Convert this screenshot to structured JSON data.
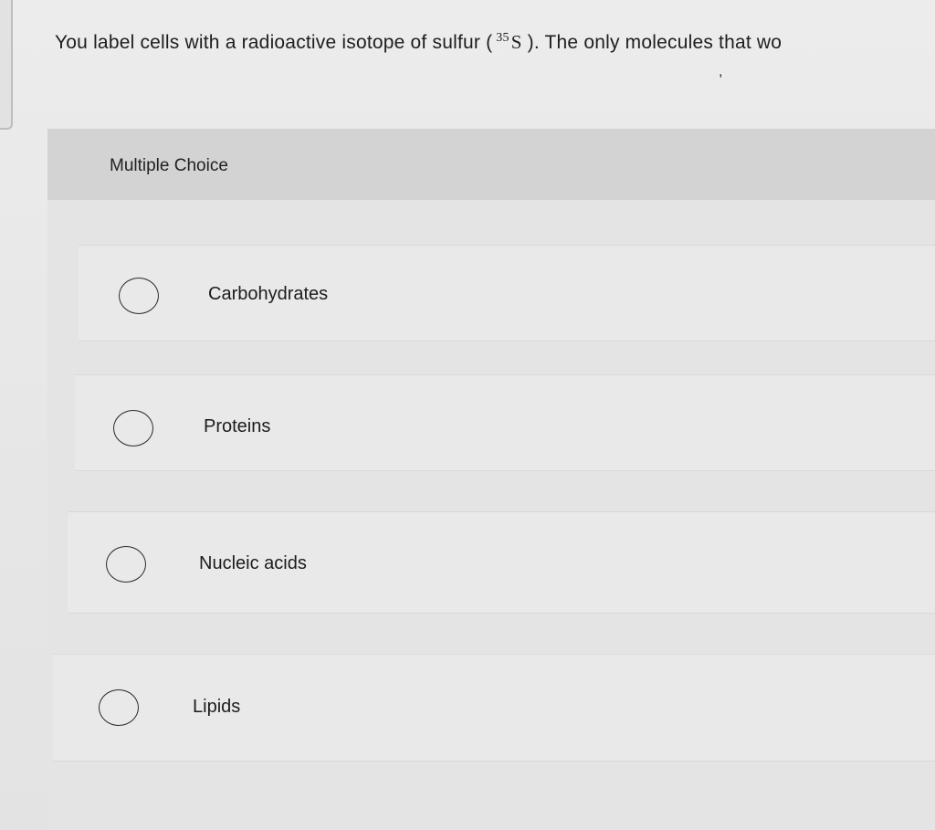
{
  "question": {
    "text_before": "You label cells with a radioactive isotope of sulfur (",
    "isotope_mass": "35",
    "isotope_symbol": "S",
    "text_after": "). The only molecules that wo"
  },
  "stray_mark": ",",
  "section": {
    "type_label": "Multiple Choice"
  },
  "options": [
    {
      "label": "Carbohydrates"
    },
    {
      "label": "Proteins"
    },
    {
      "label": "Nucleic acids"
    },
    {
      "label": "Lipids"
    }
  ]
}
